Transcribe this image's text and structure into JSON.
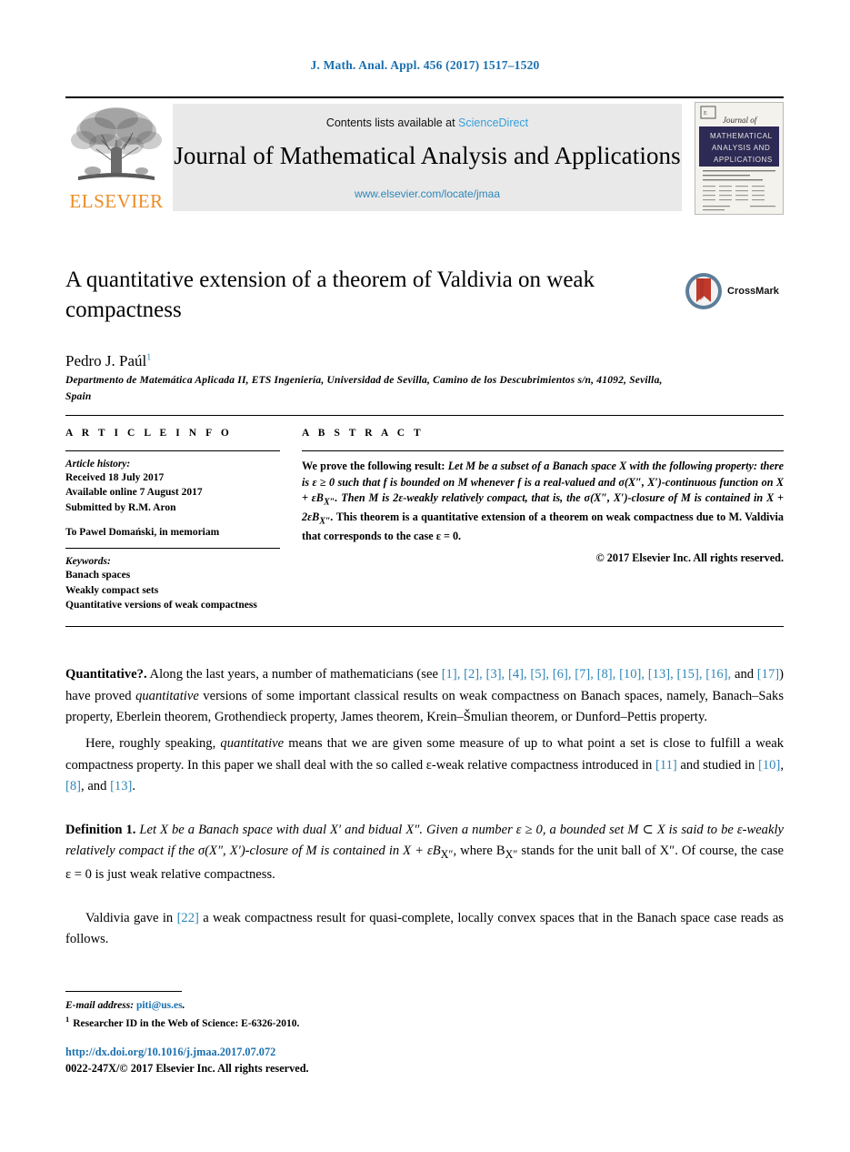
{
  "running_head": "J. Math. Anal. Appl. 456 (2017) 1517–1520",
  "masthead": {
    "publisher_wordmark": "ELSEVIER",
    "contents_prefix": "Contents lists available at ",
    "contents_link": "ScienceDirect",
    "journal_title": "Journal of Mathematical Analysis and Applications",
    "journal_url": "www.elsevier.com/locate/jmaa",
    "cover": {
      "line1": "Journal of",
      "line2": "MATHEMATICAL",
      "line3": "ANALYSIS AND",
      "line4": "APPLICATIONS"
    }
  },
  "article": {
    "title": "A quantitative extension of a theorem of Valdivia on weak compactness",
    "author": "Pedro J. Paúl",
    "author_footnote_marker": "1",
    "affiliation": "Departmento de Matemática Aplicada II, ETS Ingeniería, Universidad de Sevilla, Camino de los Descubrimientos s/n, 41092, Sevilla, Spain",
    "crossmark_label": "CrossMark"
  },
  "info": {
    "heading": "A R T I C L E   I N F O",
    "history_label": "Article history:",
    "history": [
      "Received 18 July 2017",
      "Available online 7 August 2017",
      "Submitted by R.M. Aron"
    ],
    "dedication": "To Pawel Domański, in memoriam",
    "keywords_label": "Keywords:",
    "keywords": [
      "Banach spaces",
      "Weakly compact sets",
      "Quantitative versions of weak compactness"
    ]
  },
  "abstract": {
    "heading": "A B S T R A C T",
    "lead": "We prove the following result: ",
    "statement": "Let M be a subset of a Banach space X with the following property: there is ε ≥ 0 such that f is bounded on M whenever f is a real-valued and σ(X″, X′)-continuous function on X + εB",
    "statement_sub1": "X″",
    "statement_cont": ". Then M is 2ε-weakly relatively compact, that is, the σ(X″, X′)-closure of M is contained in X + 2εB",
    "statement_sub2": "X″",
    "statement_end": ".",
    "tail": "This theorem is a quantitative extension of a theorem on weak compactness due to M. Valdivia that corresponds to the case ε = 0.",
    "copyright": "© 2017 Elsevier Inc. All rights reserved."
  },
  "body": {
    "p1_lead": "Quantitative?.",
    "p1_a": " Along the last years, a number of mathematicians (see ",
    "p1_refs_1": "[1], [2], [3], [4], [5], [6], [7], [8], [10], [13], [15], [16],",
    "p1_and": " and ",
    "p1_refs_2": "[17]",
    "p1_b": ") have proved ",
    "p1_em": "quantitative",
    "p1_c": " versions of some important classical results on weak compactness on Banach spaces, namely, Banach–Saks property, Eberlein theorem, Grothendieck property, James theorem, Krein–Šmulian theorem, or Dunford–Pettis property.",
    "p2_a": "Here, roughly speaking, ",
    "p2_em": "quantitative",
    "p2_b": " means that we are given some measure of up to what point a set is close to fulfill a weak compactness property. In this paper we shall deal with the so called ε-weak relative compactness introduced in ",
    "p2_ref1": "[11]",
    "p2_c": " and studied in ",
    "p2_ref2": "[10]",
    "p2_d": ", ",
    "p2_ref3": "[8]",
    "p2_e": ", and ",
    "p2_ref4": "[13]",
    "p2_f": ".",
    "def_lead": "Definition 1.",
    "def_text": " Let X be a Banach space with dual X′ and bidual X″. Given a number ε ≥ 0, a bounded set M ⊂ X is said to be ε-weakly relatively compact if the σ(X″, X′)-closure of M is contained in X + εB",
    "def_sub1": "X″",
    "def_text2": ", where B",
    "def_sub2": "X″",
    "def_text3": " stands for the unit ball of X″. Of course, the case ε = 0 is just weak relative compactness.",
    "p4_a": "Valdivia gave in ",
    "p4_ref": "[22]",
    "p4_b": " a weak compactness result for quasi-complete, locally convex spaces that in the Banach space case reads as follows."
  },
  "footer": {
    "email_label": "E-mail address: ",
    "email": "piti@us.es",
    "email_end": ".",
    "fn_marker": "1",
    "fn_text": "Researcher ID in the Web of Science: E-6326-2010.",
    "doi": "http://dx.doi.org/10.1016/j.jmaa.2017.07.072",
    "issn_line": "0022-247X/© 2017 Elsevier Inc. All rights reserved."
  },
  "colors": {
    "link_blue": "#2e86b8",
    "header_blue": "#1a6faf",
    "elsevier_orange": "#ec8b22",
    "cover_navy": "#2d2a56"
  }
}
